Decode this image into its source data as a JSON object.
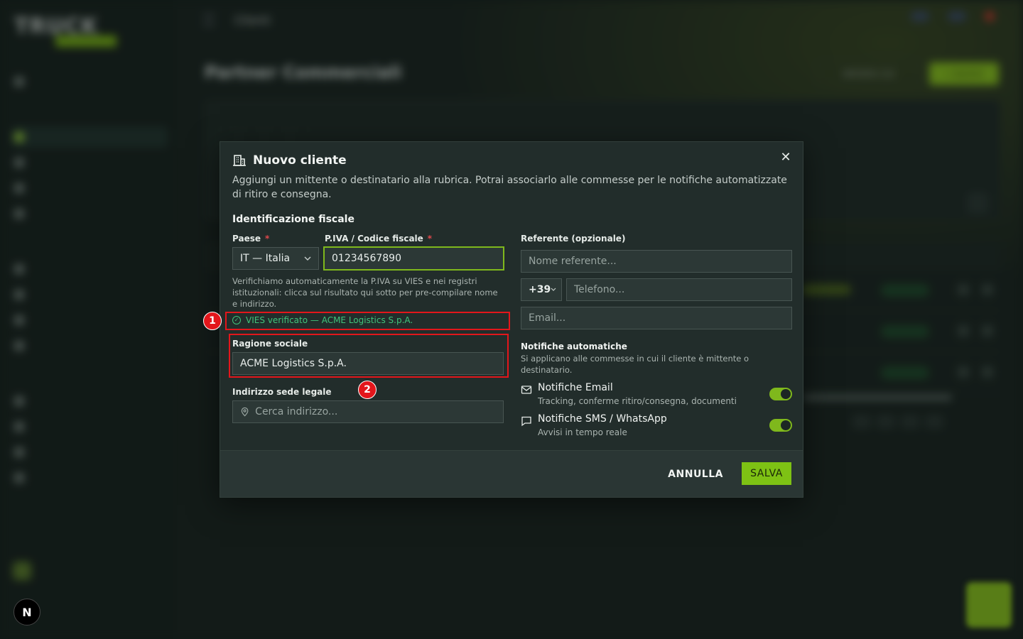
{
  "modal": {
    "title": "Nuovo cliente",
    "description": "Aggiungi un mittente o destinatario alla rubrica. Potrai associarlo alle commesse per le notifiche automatizzate di ritiro e consegna.",
    "section_title": "Identificazione fiscale",
    "country": {
      "label": "Paese",
      "value": "IT — Italia"
    },
    "vat": {
      "label": "P.IVA / Codice fiscale",
      "value": "01234567890"
    },
    "required_mark": "*",
    "helper_text": "Verifichiamo automaticamente la P.IVA su VIES e nei registri istituzionali: clicca sul risultato qui sotto per pre-compilare nome e indirizzo.",
    "vies_result": "VIES verificato — ACME Logistics S.p.A.",
    "company_name": {
      "label": "Ragione sociale",
      "value": "ACME Logistics S.p.A."
    },
    "address": {
      "label": "Indirizzo sede legale",
      "placeholder": "Cerca indirizzo..."
    },
    "contact": {
      "label": "Referente (opzionale)",
      "name_placeholder": "Nome referente...",
      "phone_prefix": "+39",
      "phone_placeholder": "Telefono...",
      "email_placeholder": "Email..."
    },
    "notifications": {
      "title": "Notifiche automatiche",
      "subtitle": "Si applicano alle commesse in cui il cliente è mittente o destinatario.",
      "email": {
        "title": "Notifiche Email",
        "subtitle": "Tracking, conferme ritiro/consegna, documenti",
        "enabled": true
      },
      "sms": {
        "title": "Notifiche SMS / WhatsApp",
        "subtitle": "Avvisi in tempo reale",
        "enabled": true
      }
    },
    "cancel_label": "ANNULLA",
    "save_label": "SALVA"
  },
  "annotations": [
    "1",
    "2"
  ],
  "background": {
    "logo": "TRUCK",
    "breadcrumb": "Clienti",
    "page_title": "Partner Commerciali",
    "import_label": "IMPORTA CSV",
    "new_label": "+ NUOVO",
    "n_badge": "N"
  },
  "colors": {
    "accent": "#7ec214",
    "success": "#3fc47b",
    "annotation": "#e3161b"
  }
}
